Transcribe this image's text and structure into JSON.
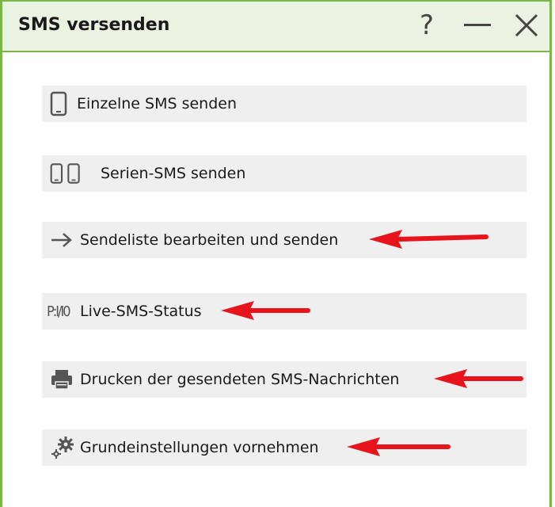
{
  "window": {
    "title": "SMS versenden",
    "help_label": "?",
    "minimize_label": "—",
    "close_label": "✕"
  },
  "menu": {
    "items": [
      {
        "label": "Einzelne SMS senden",
        "icon": "phone-icon"
      },
      {
        "label": "Serien-SMS senden",
        "icon": "two-phones-icon"
      },
      {
        "label": "Sendeliste bearbeiten und senden",
        "icon": "arrow-right-icon"
      },
      {
        "label": "Live-SMS-Status",
        "icon": "status-icon"
      },
      {
        "label": "Drucken der gesendeten SMS-Nachrichten",
        "icon": "printer-icon"
      },
      {
        "label": "Grundeinstellungen vornehmen",
        "icon": "gears-icon"
      }
    ],
    "status_icon_text": "P:I/I0"
  },
  "colors": {
    "accent": "#7ab648",
    "titlebar_bg": "#eaf3e2",
    "button_bg": "#efefef",
    "annotation_arrow": "#e8141b"
  }
}
